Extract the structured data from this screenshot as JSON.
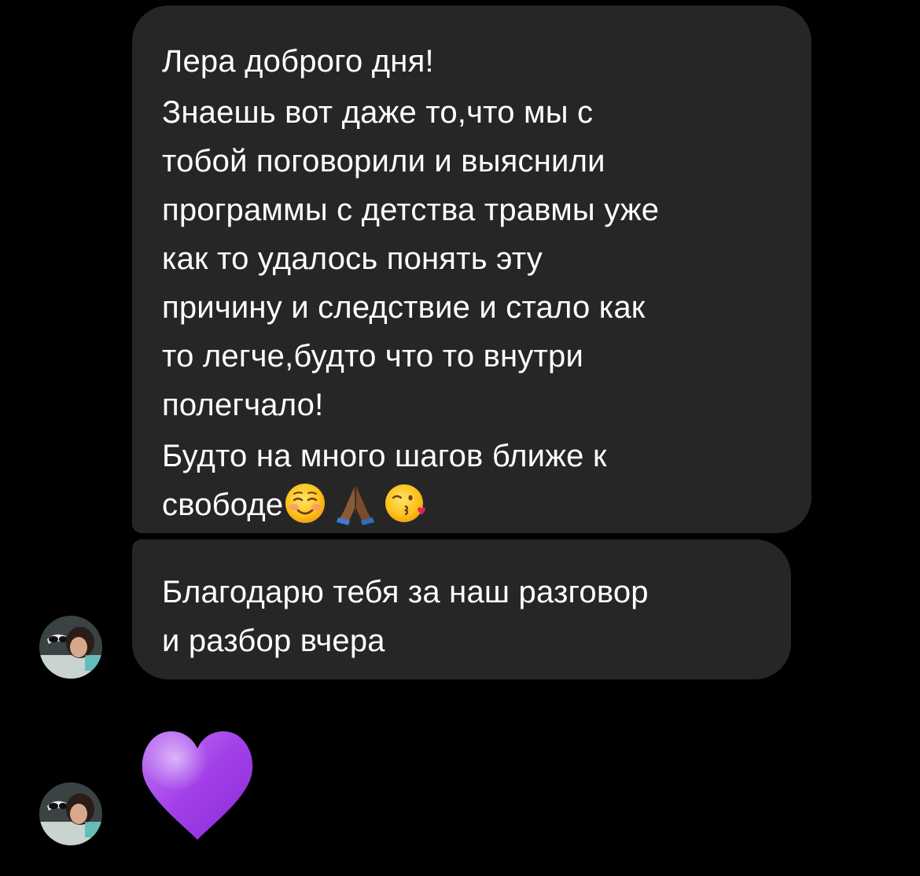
{
  "conversation": {
    "message_1": {
      "lines": [
        "Лера доброго дня!",
        "Знаешь вот даже то,что мы с",
        "тобой поговорили и выяснили",
        "программы с детства травмы уже",
        "как то удалось понять эту",
        "причину и следствие и стало как",
        "то легче,будто что то внутри",
        "полегчало!",
        "Будто на много шагов ближе к",
        "свободе"
      ],
      "emojis": [
        "smiling-blush-emoji",
        "folded-hands-emoji",
        "kissing-heart-emoji"
      ]
    },
    "message_2": {
      "lines": [
        "Благодарю тебя за наш разговор",
        "и разбор вчера"
      ]
    },
    "message_3": {
      "content": "purple-heart-emoji"
    }
  },
  "colors": {
    "background": "#000000",
    "bubble": "#262626",
    "text": "#ffffff",
    "heart": "#a23fe8"
  }
}
